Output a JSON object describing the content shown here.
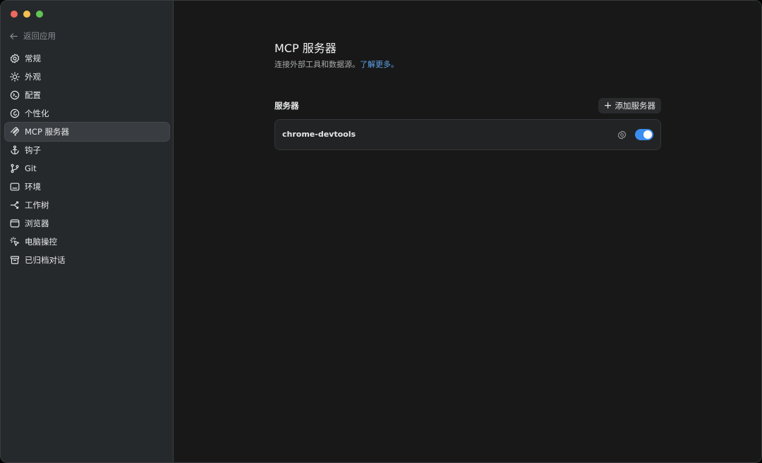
{
  "sidebar": {
    "back_label": "返回应用",
    "items": [
      {
        "label": "常规",
        "icon": "gear-icon"
      },
      {
        "label": "外观",
        "icon": "sun-icon"
      },
      {
        "label": "配置",
        "icon": "config-icon"
      },
      {
        "label": "个性化",
        "icon": "personalize-icon"
      },
      {
        "label": "MCP 服务器",
        "icon": "mcp-icon"
      },
      {
        "label": "钩子",
        "icon": "anchor-icon"
      },
      {
        "label": "Git",
        "icon": "git-branch-icon"
      },
      {
        "label": "环境",
        "icon": "terminal-icon"
      },
      {
        "label": "工作树",
        "icon": "worktree-icon"
      },
      {
        "label": "浏览器",
        "icon": "browser-icon"
      },
      {
        "label": "电脑操控",
        "icon": "pointer-click-icon"
      },
      {
        "label": "已归档对话",
        "icon": "archive-icon"
      }
    ],
    "active_item": "MCP 服务器"
  },
  "main": {
    "title": "MCP 服务器",
    "subtitle": "连接外部工具和数据源。",
    "subtitle_link": "了解更多。",
    "section_label": "服务器",
    "add_button_label": "添加服务器",
    "servers": [
      {
        "name": "chrome-devtools",
        "enabled": true
      }
    ]
  },
  "colors": {
    "accent": "#3b8ef0",
    "link": "#5ea3ec",
    "sidebar_bg": "#26292c",
    "main_bg": "#181818"
  }
}
